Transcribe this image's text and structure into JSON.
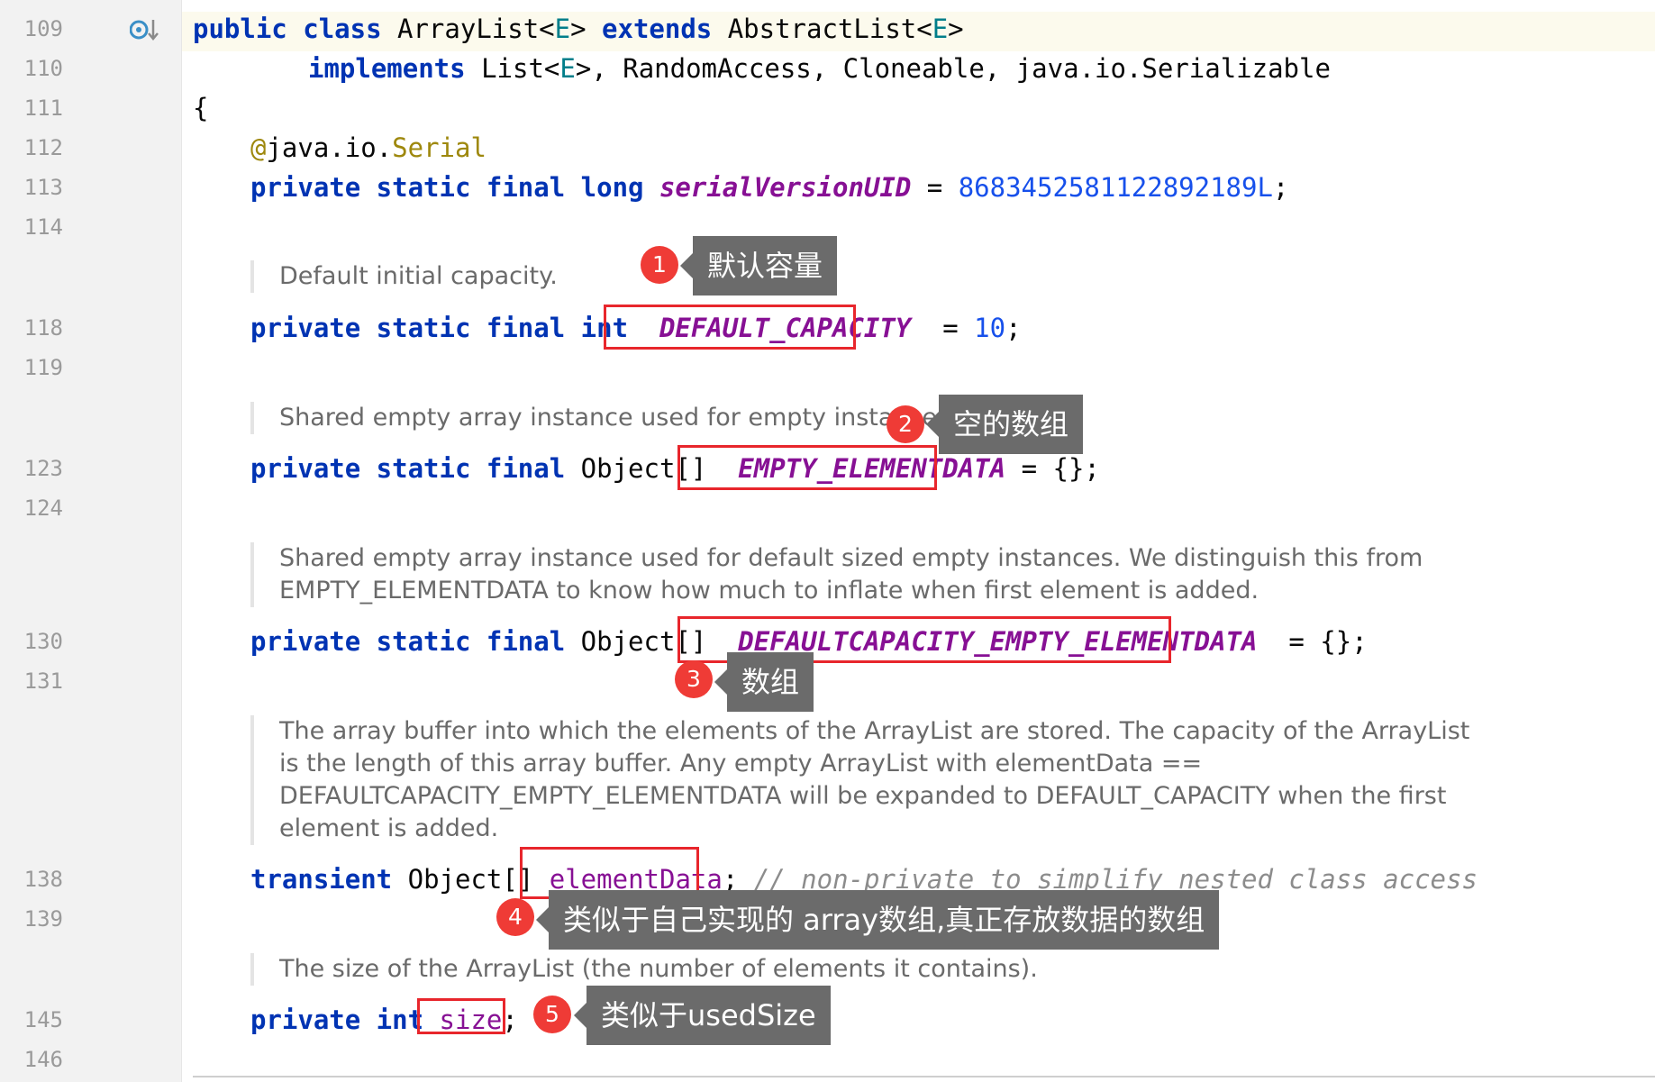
{
  "gutter": {
    "line_numbers": [
      "109",
      "110",
      "111",
      "112",
      "113",
      "114",
      "118",
      "119",
      "123",
      "124",
      "130",
      "131",
      "138",
      "139",
      "145",
      "146"
    ],
    "icon": "override-method-icon"
  },
  "code": {
    "l109": {
      "public": "public",
      "class": "class",
      "name": "ArrayList<",
      "type_param": "E",
      "gt_extends": ">",
      "extends": "extends",
      "parent": "AbstractList<",
      "type_param2": "E",
      "gt": ">"
    },
    "l110": {
      "implements": "implements",
      "list": "List<",
      "type_param": "E",
      "rest": ">, RandomAccess, Cloneable, java.io.Serializable"
    },
    "l111": "{",
    "l112": {
      "at": "@",
      "pkg": "java.io.",
      "serial": "Serial"
    },
    "l113": {
      "mods": "private static final long",
      "name": "serialVersionUID",
      "eq": " = ",
      "value": "8683452581122892189L",
      "semi": ";"
    },
    "doc1": [
      "Default initial capacity."
    ],
    "l118": {
      "mods": "private static final int",
      "name": "DEFAULT_CAPACITY",
      "eq": "= ",
      "value": "10",
      "semi": ";"
    },
    "doc2": [
      "Shared empty array instance used for empty instances."
    ],
    "l123": {
      "mods": "private static final",
      "type": "Object[]",
      "name": "EMPTY_ELEMENTDATA",
      "rest": "= {};"
    },
    "doc3": [
      "Shared empty array instance used for default sized empty instances. We distinguish this from",
      "EMPTY_ELEMENTDATA to know how much to inflate when first element is added."
    ],
    "l130": {
      "mods": "private static final",
      "type": "Object[]",
      "name": "DEFAULTCAPACITY_EMPTY_ELEMENTDATA",
      "rest": "= {};"
    },
    "doc4": [
      "The array buffer into which the elements of the ArrayList are stored. The capacity of the ArrayList",
      "is the length of this array buffer. Any empty ArrayList with elementData ==",
      "DEFAULTCAPACITY_EMPTY_ELEMENTDATA will be expanded to DEFAULT_CAPACITY when the first",
      "element is added."
    ],
    "l138": {
      "mods": "transient",
      "type": "Object[]",
      "name": "elementData",
      "semi": ";",
      "comment": "// non-private to simplify nested class access"
    },
    "doc5": [
      "The size of the ArrayList (the number of elements it contains)."
    ],
    "l145": {
      "mods": "private int",
      "name": "size",
      "semi": ";"
    }
  },
  "annotations": [
    {
      "number": "1",
      "text": "默认容量"
    },
    {
      "number": "2",
      "text": "空的数组"
    },
    {
      "number": "3",
      "text": "数组"
    },
    {
      "number": "4",
      "text": "类似于自己实现的 array数组,真正存放数据的数组"
    },
    {
      "number": "5",
      "text": "类似于usedSize"
    }
  ],
  "colors": {
    "keyword": "#0033b3",
    "static_field": "#871094",
    "number": "#1750eb",
    "annotation_box": "#e8262c",
    "marker": "#ef3b36",
    "tooltip": "#6b6b6b"
  }
}
